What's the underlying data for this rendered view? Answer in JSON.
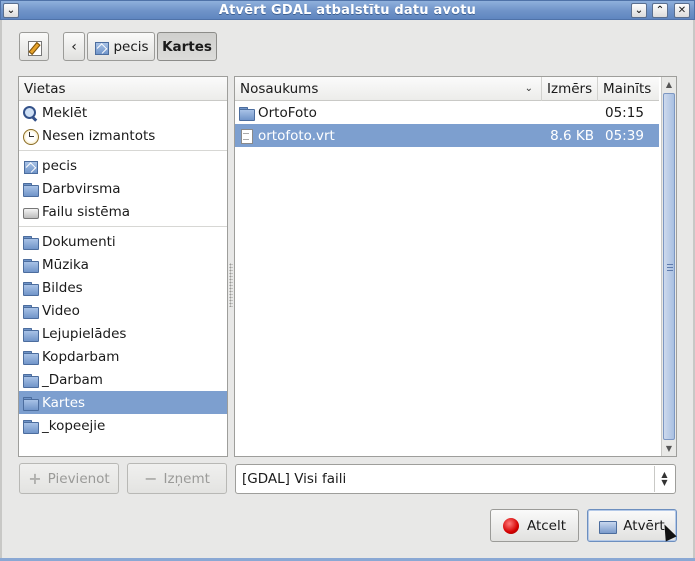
{
  "window": {
    "title": "Atvērt GDAL atbalstītu datu avotu",
    "menu_glyph": "⌄",
    "min_glyph": "⌄",
    "max_glyph": "⌃",
    "close_glyph": "✕"
  },
  "pathbar": {
    "back_glyph": "‹",
    "crumbs": [
      {
        "label": "pecis",
        "icon": "home-icon"
      },
      {
        "label": "Kartes"
      }
    ]
  },
  "places": {
    "header": "Vietas",
    "items": [
      {
        "label": "Meklēt",
        "icon": "search-icon"
      },
      {
        "label": "Nesen izmantots",
        "icon": "clock-icon"
      },
      {
        "label": "pecis",
        "icon": "home-icon"
      },
      {
        "label": "Darbvirsma",
        "icon": "folder-icon"
      },
      {
        "label": "Failu sistēma",
        "icon": "drive-icon"
      },
      {
        "label": "Dokumenti",
        "icon": "folder-icon"
      },
      {
        "label": "Mūzika",
        "icon": "folder-icon"
      },
      {
        "label": "Bildes",
        "icon": "folder-icon"
      },
      {
        "label": "Video",
        "icon": "folder-icon"
      },
      {
        "label": "Lejupielādes",
        "icon": "folder-icon"
      },
      {
        "label": "Kopdarbam",
        "icon": "folder-icon"
      },
      {
        "label": "_Darbam",
        "icon": "folder-icon"
      },
      {
        "label": "Kartes",
        "icon": "folder-icon",
        "selected": true
      },
      {
        "label": "_kopeejie",
        "icon": "folder-icon"
      }
    ]
  },
  "files": {
    "columns": {
      "name": "Nosaukums",
      "size": "Izmērs",
      "modified": "Mainīts"
    },
    "sort_glyph": "⌄",
    "rows": [
      {
        "name": "OrtoFoto",
        "size": "",
        "modified": "05:15",
        "icon": "folder-icon"
      },
      {
        "name": "ortofoto.vrt",
        "size": "8.6 KB",
        "modified": "05:39",
        "icon": "doc-icon",
        "selected": true
      }
    ]
  },
  "buttons": {
    "add": "Pievienot",
    "remove": "Izņemt",
    "cancel": "Atcelt",
    "open": "Atvērt"
  },
  "filter": {
    "value": "[GDAL] Visi faili"
  },
  "colors": {
    "selection": "#7d9fcf",
    "titlebar": "#6f93c8"
  }
}
